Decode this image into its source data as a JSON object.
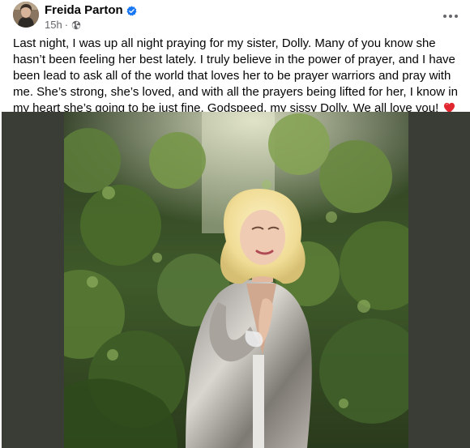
{
  "post": {
    "author": {
      "name": "Freida Parton",
      "verified": true,
      "verified_color": "#1877f2"
    },
    "timestamp": "15h",
    "separator": "·",
    "audience_icon": "globe-icon",
    "more_icon": "more-horizontal-icon",
    "text": "Last night, I was up all night praying for my sister, Dolly. Many of you know she hasn’t been feeling her best lately. I truly believe in the power of prayer, and I have been lead to ask all of the world that loves her to be prayer warriors and pray with me. She’s strong, she’s loved, and with all the prayers being lifted for her, I know in my heart she’s going to be just fine. Godspeed, my sissy Dolly. We all love you!",
    "emoji": "red-heart-icon",
    "image": {
      "frame_color": "#3a3c36"
    }
  }
}
